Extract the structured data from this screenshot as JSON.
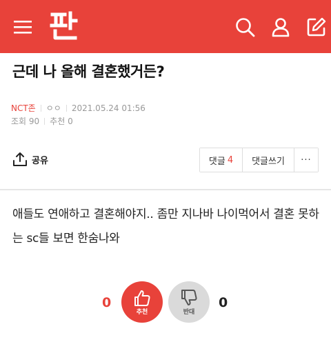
{
  "header": {
    "logo_text": "판",
    "icons": [
      "menu-icon",
      "search-icon",
      "user-icon",
      "write-icon"
    ],
    "brand_color": "#e8423a"
  },
  "post": {
    "title": "근데 나 올해 결혼했거든?",
    "author": "NCT존",
    "nickname": "ㅇㅇ",
    "datetime": "2021.05.24 01:56",
    "views_label": "조회 90",
    "likes_label": "추천 0",
    "body": "애들도 연애하고 결혼해야지.. 좀만 지나바 나이먹어서 결혼 못하는 sc들 보면 한숨나와"
  },
  "actions": {
    "share_label": "공유",
    "comments_label": "댓글",
    "comments_count": "4",
    "write_comment_label": "댓글쓰기",
    "more_label": "···"
  },
  "vote": {
    "up_count": "0",
    "up_label": "추천",
    "down_count": "0",
    "down_label": "반대"
  }
}
